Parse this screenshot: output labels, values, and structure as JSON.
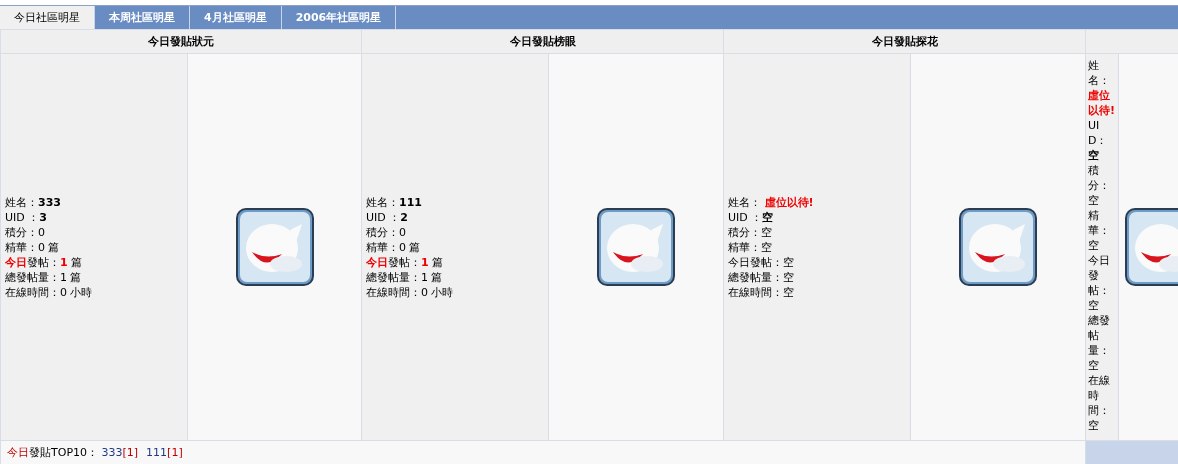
{
  "tabs": [
    {
      "label": "今日社區明星",
      "selected": true
    },
    {
      "label": "本周社區明星",
      "selected": false
    },
    {
      "label": "4月社區明星",
      "selected": false
    },
    {
      "label": "2006年社區明星",
      "selected": false
    }
  ],
  "headers": [
    "今日發貼狀元",
    "今日發貼榜眼",
    "今日發貼探花"
  ],
  "stars": [
    {
      "kind": "filled",
      "lines": [
        {
          "label": "姓名：",
          "value": "333"
        },
        {
          "label": "UID ：",
          "value": "3"
        },
        {
          "label": "積分：",
          "value": "0"
        },
        {
          "label": "精華：",
          "value": "0 篇"
        },
        {
          "highlight": "今日",
          "label": "發帖：",
          "value": "1",
          "unit": " 篇"
        },
        {
          "label": "總發帖量：",
          "value": "1 篇"
        },
        {
          "label": "在線時間：",
          "value": "0 小時"
        }
      ]
    },
    {
      "kind": "filled",
      "lines": [
        {
          "label": "姓名：",
          "value": "111"
        },
        {
          "label": "UID ：",
          "value": "2"
        },
        {
          "label": "積分：",
          "value": "0"
        },
        {
          "label": "精華：",
          "value": "0 篇"
        },
        {
          "highlight": "今日",
          "label": "發帖：",
          "value": "1",
          "unit": " 篇"
        },
        {
          "label": "總發帖量：",
          "value": "1 篇"
        },
        {
          "label": "在線時間：",
          "value": "0 小時"
        }
      ]
    },
    {
      "kind": "vacant",
      "lines": [
        {
          "label": "姓名： ",
          "value": "虛位以待!"
        },
        {
          "label": "UID ：",
          "value": "空"
        },
        {
          "label": "積分：",
          "value": "空"
        },
        {
          "label": "精華：",
          "value": "空"
        },
        {
          "label": "今日發帖：",
          "value": "空"
        },
        {
          "label": "總發帖量：",
          "value": "空"
        },
        {
          "label": "在線時間：",
          "value": "空"
        }
      ]
    },
    {
      "kind": "narrow",
      "lines": [
        {
          "label": "姓名：",
          "value": "虛位以待!"
        },
        {
          "label": "UID：",
          "value": "空"
        },
        {
          "label": "積分：",
          "value": "空"
        },
        {
          "label": "精華：",
          "value": "空"
        },
        {
          "label": "今日發帖：",
          "value": "空"
        },
        {
          "label": "總發帖量：",
          "value": "空"
        },
        {
          "label": "在線時間：",
          "value": "空"
        }
      ]
    }
  ],
  "footer": {
    "highlight": "今日",
    "label": "發貼TOP10：",
    "entries": [
      {
        "name": "333",
        "count": "[1]"
      },
      {
        "name": "111",
        "count": "[1]"
      }
    ]
  }
}
